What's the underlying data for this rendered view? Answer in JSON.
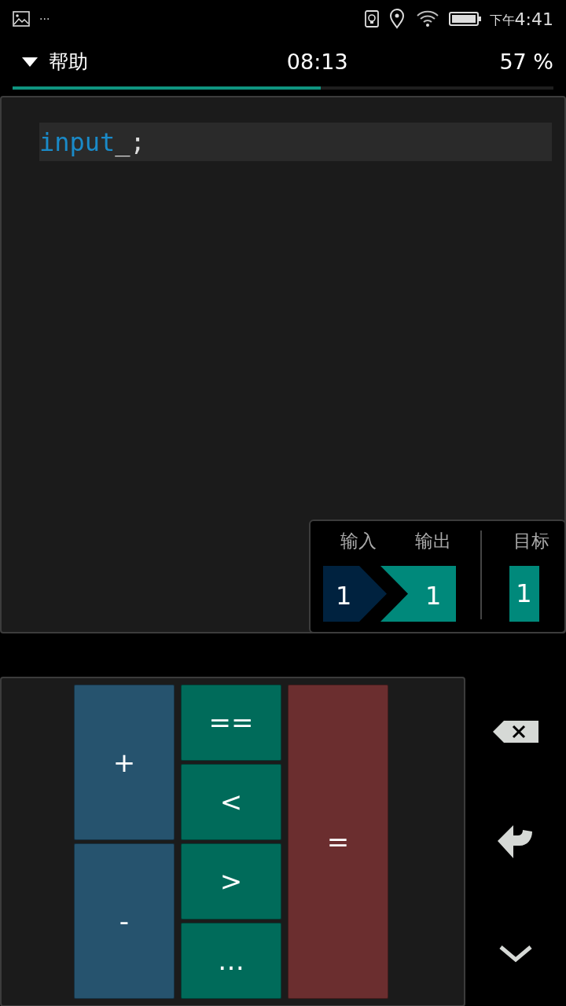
{
  "status_bar": {
    "overflow": "···",
    "time_prefix": "下午",
    "time": "4:41"
  },
  "header": {
    "menu_label": "帮助",
    "timer": "08:13",
    "percent": "57 %",
    "progress": {
      "level": 0.57
    }
  },
  "editor": {
    "tokens": [
      {
        "text": "input",
        "kind": "keyword"
      },
      {
        "text": "_;",
        "kind": "plain"
      }
    ]
  },
  "io_panel": {
    "input_label": "输入",
    "output_label": "输出",
    "target_label": "目标",
    "input_value": "1",
    "output_value": "1",
    "target_value": "1"
  },
  "keypad": {
    "columns": [
      [
        {
          "label": "+",
          "kind": "arith"
        },
        {
          "label": "-",
          "kind": "arith"
        }
      ],
      [
        {
          "label": "==",
          "kind": "compare"
        },
        {
          "label": "<",
          "kind": "compare"
        },
        {
          "label": ">",
          "kind": "compare"
        },
        {
          "label": "…",
          "kind": "compare"
        }
      ],
      [
        {
          "label": "=",
          "kind": "assign"
        }
      ]
    ]
  }
}
